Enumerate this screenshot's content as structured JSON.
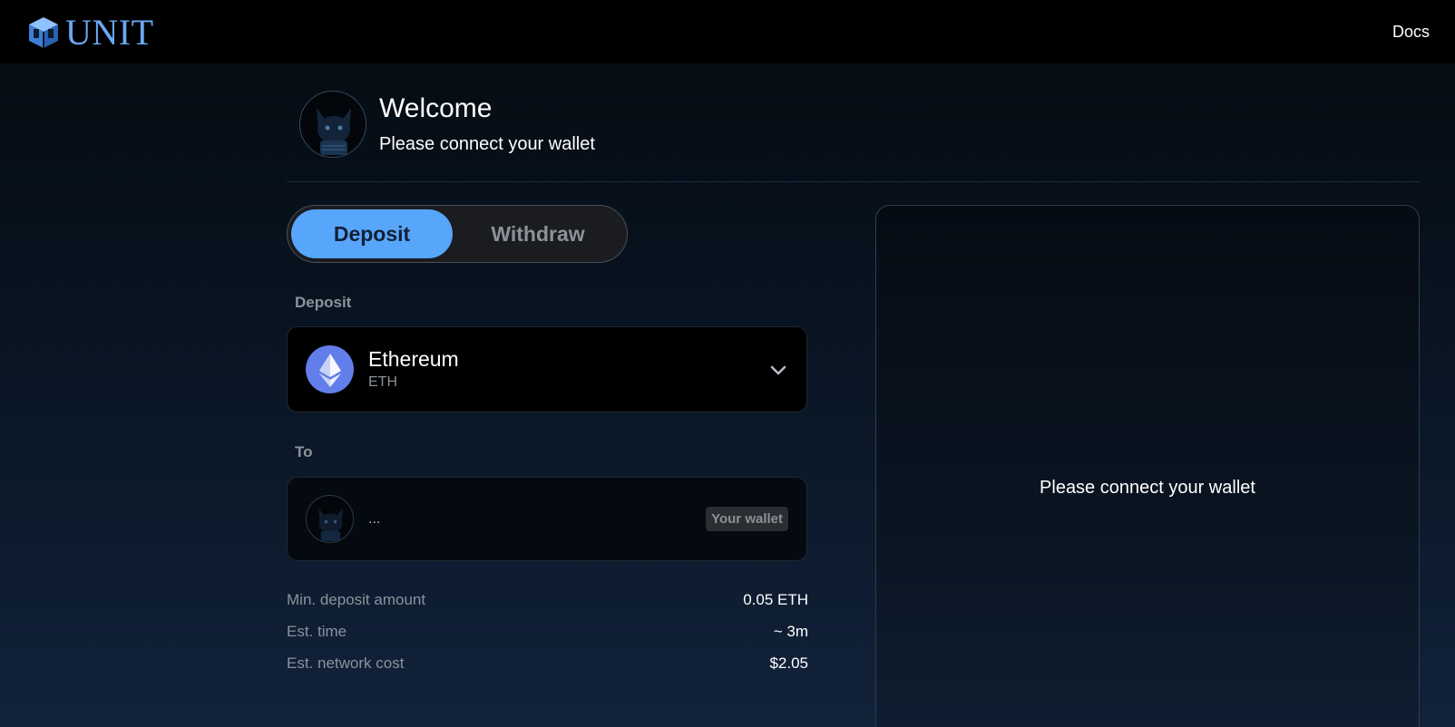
{
  "header": {
    "logo_text": "UNIT",
    "docs_label": "Docs"
  },
  "welcome": {
    "title": "Welcome",
    "subtitle": "Please connect your wallet"
  },
  "tabs": {
    "deposit_label": "Deposit",
    "withdraw_label": "Withdraw",
    "active": "Deposit"
  },
  "deposit": {
    "section_label": "Deposit",
    "asset_name": "Ethereum",
    "asset_symbol": "ETH",
    "asset_icon": "ethereum-icon"
  },
  "to": {
    "section_label": "To",
    "address": "...",
    "badge": "Your wallet"
  },
  "info": [
    {
      "label": "Min. deposit amount",
      "value": "0.05 ETH"
    },
    {
      "label": "Est. time",
      "value": "~ 3m"
    },
    {
      "label": "Est. network cost",
      "value": "$2.05"
    }
  ],
  "panel": {
    "message": "Please connect your wallet"
  },
  "colors": {
    "accent": "#58a6fb",
    "logo": "#6aa8f2",
    "eth": "#627eea"
  }
}
